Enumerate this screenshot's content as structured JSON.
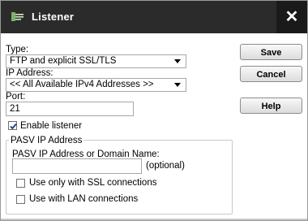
{
  "dialog": {
    "title": "Listener",
    "close_label": "✕"
  },
  "form": {
    "type_label": "Type:",
    "type_value": "FTP and explicit SSL/TLS",
    "ip_label": "IP Address:",
    "ip_value": "<< All Available IPv4 Addresses >>",
    "port_label": "Port:",
    "port_value": "21",
    "enable_listener_label": "Enable listener",
    "enable_listener_checked": true
  },
  "pasv": {
    "legend": "PASV IP Address",
    "address_label": "PASV IP Address or Domain Name:",
    "address_value": "",
    "optional_label": "(optional)",
    "ssl_only_label": "Use only with SSL connections",
    "ssl_only_checked": false,
    "lan_label": "Use with LAN connections",
    "lan_checked": false
  },
  "buttons": {
    "save": "Save",
    "cancel": "Cancel",
    "help": "Help"
  }
}
